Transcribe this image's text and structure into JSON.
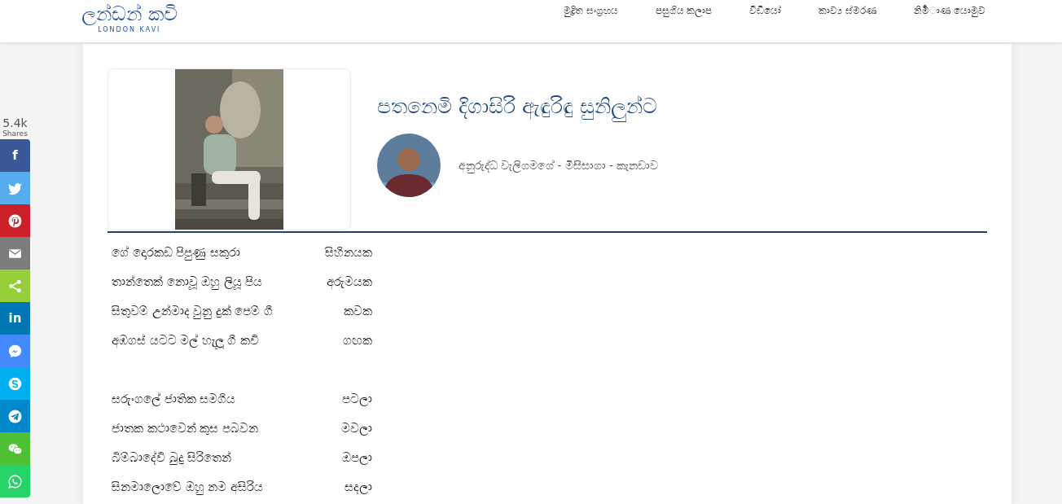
{
  "header": {
    "logo": {
      "title": "ලන්ඩන් කවි",
      "subtitle": "LONDON KAVI"
    },
    "nav": [
      {
        "label": "මුද්‍රිත සංග්‍රහය"
      },
      {
        "label": "පසුගිය කලාප"
      },
      {
        "label": "වීඩියෝ"
      },
      {
        "label": "කාව්‍ය ස්මරණ"
      },
      {
        "label": "නිමර්‍ාණ යොමුව"
      }
    ]
  },
  "share": {
    "count": "5.4k",
    "count_label": "Shares",
    "buttons": [
      {
        "kind": "facebook",
        "color": "#3b5998",
        "label": "f"
      },
      {
        "kind": "twitter",
        "color": "#55acee"
      },
      {
        "kind": "pinterest",
        "color": "#cb2027"
      },
      {
        "kind": "email",
        "color": "#7d7d7d"
      },
      {
        "kind": "share",
        "color": "#95d03a"
      },
      {
        "kind": "linkedin",
        "color": "#0077b5",
        "label": "in"
      },
      {
        "kind": "messenger",
        "color": "#448aff"
      },
      {
        "kind": "skype",
        "color": "#00aff0"
      },
      {
        "kind": "telegram",
        "color": "#0088cc"
      },
      {
        "kind": "wechat",
        "color": "#4ec034"
      },
      {
        "kind": "whatsapp",
        "color": "#25d366"
      }
    ]
  },
  "article": {
    "title": "පතනෙමි දිගාසිරි ඇඳුරිඳු සුනිලුන්ට",
    "author": "අනුරුද්ධ වැලිගමගේ - මිසිසාගා - කැනඩාව",
    "stanzas": [
      {
        "lines": [
          {
            "text": "ගේ දොරකඩ පිපුණු සකුරා",
            "end": "සිහිනයක"
          },
          {
            "text": "තාන්තෙක් නොවූ ඔහු ලියූ පිය",
            "end": "අරුමයක"
          },
          {
            "text": "සිතුවම් උන්මාද වුනු දුක් පෙම් ගී",
            "end": "කවක"
          },
          {
            "text": "අඹගස් යටට මල් හැලූ ගී කවි",
            "end": "ගඟක"
          }
        ]
      },
      {
        "lines": [
          {
            "text": "සරුංගලේ ජාතික සමගිය",
            "end": "පටලා"
          },
          {
            "text": "ජාතක කථාවෙන් කුස පබවන",
            "end": "මවලා"
          },
          {
            "text": "බිම්බාදේවි බුදු සිරිතෙන්",
            "end": "ඔපලා"
          },
          {
            "text": "සිනමාලොවේ ඔහු නම අසිරිය",
            "end": "සදලා"
          }
        ]
      }
    ]
  }
}
